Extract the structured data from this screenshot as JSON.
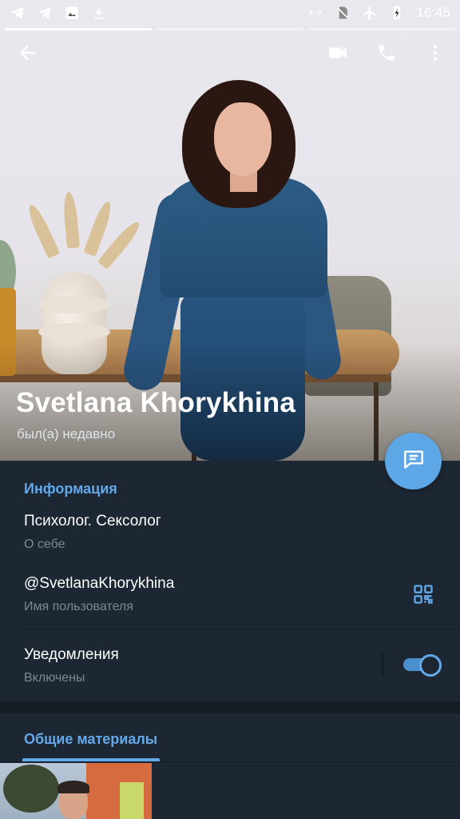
{
  "status_bar": {
    "time": "16:45",
    "left_icons": [
      "telegram-icon",
      "telegram-icon",
      "image-icon",
      "download-icon"
    ],
    "right_icons": [
      "data-saver-icon",
      "no-sim-icon",
      "airplane-icon",
      "battery-charging-icon"
    ]
  },
  "story_progress": {
    "segments": 3,
    "active_index": 0
  },
  "header": {
    "back_icon": "arrow-left-icon",
    "actions": [
      "video-call-icon",
      "phone-icon",
      "more-vert-icon"
    ]
  },
  "profile": {
    "name": "Svetlana Khorykhina",
    "status": "был(а) недавно"
  },
  "fab": {
    "icon": "message-icon"
  },
  "info": {
    "title": "Информация",
    "bio_value": "Психолог. Сексолог",
    "bio_label": "О себе",
    "username_value": "@SvetlanaKhorykhina",
    "username_label": "Имя пользователя",
    "qr_icon": "qr-code-icon",
    "notifications_value": "Уведомления",
    "notifications_label": "Включены",
    "notifications_enabled": true
  },
  "media": {
    "tab_label": "Общие материалы"
  },
  "colors": {
    "accent": "#63a9ea",
    "background": "#1d2733",
    "fab": "#5ea7e6",
    "secondary_text": "#7c8894"
  }
}
